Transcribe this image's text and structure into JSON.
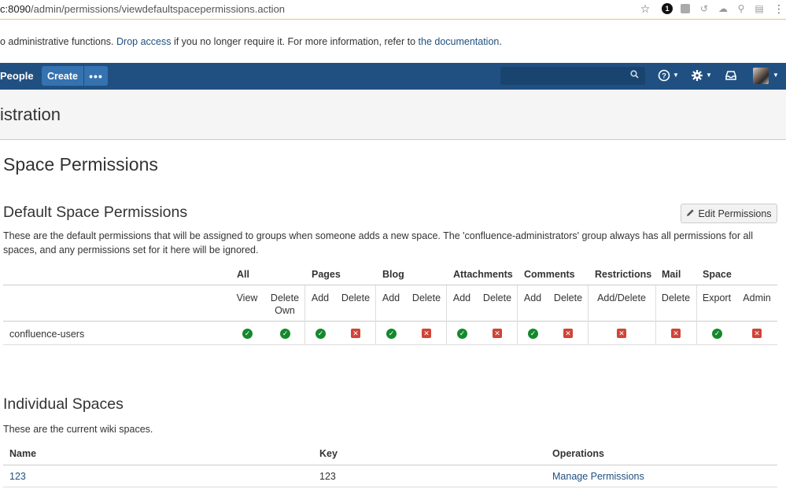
{
  "browser": {
    "url_host": "c:8090",
    "url_path": "/admin/permissions/viewdefaultspacepermissions.action",
    "extension_badge": "1"
  },
  "banner": {
    "text_before": "o administrative functions. ",
    "drop_access_link": "Drop access",
    "text_middle": " if you no longer require it. For more information, refer to ",
    "documentation_link": "the documentation",
    "text_after": "."
  },
  "header": {
    "people_label": "People",
    "create_label": "Create",
    "more_label": "•••",
    "search_placeholder": ""
  },
  "page": {
    "title": "istration"
  },
  "main": {
    "heading": "Space Permissions",
    "default_section": {
      "heading": "Default Space Permissions",
      "edit_button_label": "Edit Permissions",
      "description": "These are the default permissions that will be assigned to groups when someone adds a new space. The 'confluence-administrators' group always has all permissions for all spaces, and any permissions set for it here will be ignored.",
      "groups": [
        "All",
        "Pages",
        "Blog",
        "Attachments",
        "Comments",
        "Restrictions",
        "Mail",
        "Space"
      ],
      "columns": [
        {
          "label1": "View",
          "label2": ""
        },
        {
          "label1": "Delete",
          "label2": "Own"
        },
        {
          "label1": "Add",
          "label2": ""
        },
        {
          "label1": "Delete",
          "label2": ""
        },
        {
          "label1": "Add",
          "label2": ""
        },
        {
          "label1": "Delete",
          "label2": ""
        },
        {
          "label1": "Add",
          "label2": ""
        },
        {
          "label1": "Delete",
          "label2": ""
        },
        {
          "label1": "Add",
          "label2": ""
        },
        {
          "label1": "Delete",
          "label2": ""
        },
        {
          "label1": "Add/Delete",
          "label2": ""
        },
        {
          "label1": "Delete",
          "label2": ""
        },
        {
          "label1": "Export",
          "label2": ""
        },
        {
          "label1": "Admin",
          "label2": ""
        }
      ],
      "rows": [
        {
          "group": "confluence-users",
          "permissions": [
            true,
            true,
            true,
            false,
            true,
            false,
            true,
            false,
            true,
            false,
            false,
            false,
            true,
            false
          ]
        }
      ]
    },
    "individual_section": {
      "heading": "Individual Spaces",
      "description": "These are the current wiki spaces.",
      "headers": {
        "name": "Name",
        "key": "Key",
        "operations": "Operations"
      },
      "rows": [
        {
          "name": "123",
          "key": "123",
          "operation": "Manage Permissions"
        }
      ]
    }
  },
  "colors": {
    "header_bg": "#205081",
    "button_bg": "#3572b0",
    "link": "#205081",
    "granted": "#14892c",
    "denied": "#d04437"
  }
}
